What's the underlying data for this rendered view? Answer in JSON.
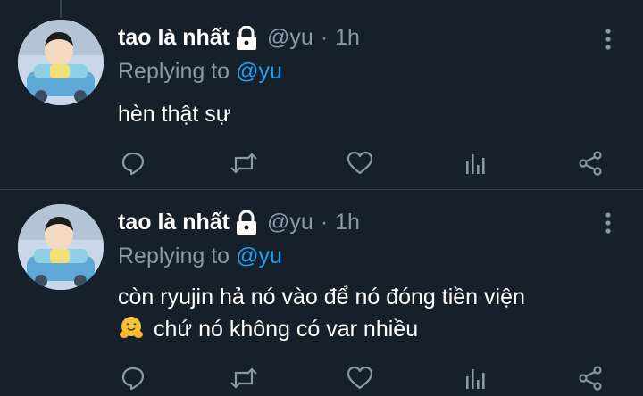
{
  "colors": {
    "background": "#15202b",
    "divider": "#38444d",
    "text": "#ffffff",
    "secondary": "#8899a6",
    "link": "#1da1f2"
  },
  "tweets": [
    {
      "display_name": "tao là nhất",
      "handle": "@yu",
      "separator": "·",
      "time": "1h",
      "replying_prefix": "Replying to",
      "replying_handle": "@yu",
      "text_lines": [
        "hèn thật sự"
      ],
      "icons": [
        "lock-icon",
        "more-icon",
        "reply-icon",
        "retweet-icon",
        "like-icon",
        "stats-icon",
        "share-icon"
      ]
    },
    {
      "display_name": "tao là nhất",
      "handle": "@yu",
      "separator": "·",
      "time": "1h",
      "replying_prefix": "Replying to",
      "replying_handle": "@yu",
      "text_lines": [
        "còn ryujin hả nó vào để nó đóng tiền viện",
        "chứ nó không có var nhiều"
      ],
      "emoji": "hugging-face-emoji",
      "icons": [
        "lock-icon",
        "more-icon",
        "reply-icon",
        "retweet-icon",
        "like-icon",
        "stats-icon",
        "share-icon"
      ]
    }
  ]
}
